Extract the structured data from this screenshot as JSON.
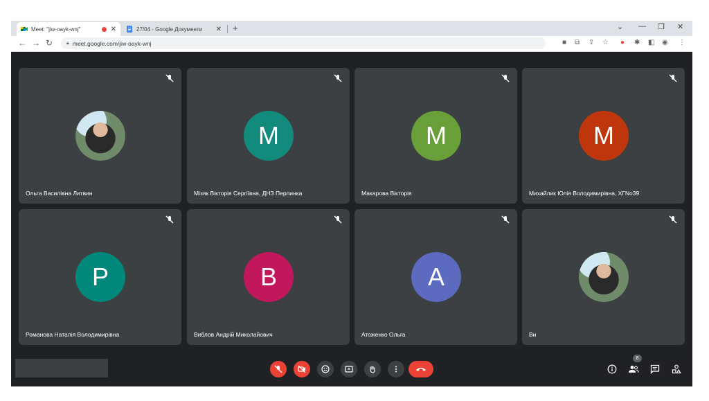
{
  "browser": {
    "tabs": [
      {
        "title": "Meet: \"jiw-oayk-wnj\"",
        "active": true,
        "recording": true
      },
      {
        "title": "27/04 - Google Документи",
        "active": false
      }
    ],
    "address": "meet.google.com/jiw-oayk-wnj"
  },
  "meet": {
    "participants": [
      {
        "name": "Ольга Василівна Литвин",
        "initial": "",
        "photo": true,
        "color": ""
      },
      {
        "name": "Мізяк Вікторія Сергіївна, ДНЗ Перлинка",
        "initial": "M",
        "color": "#128a7c"
      },
      {
        "name": "Макарова Вікторія",
        "initial": "M",
        "color": "#689f38"
      },
      {
        "name": "Михайлик Юлія Володимирівна, ХГNo39",
        "initial": "M",
        "color": "#bf360c"
      },
      {
        "name": "Романова Наталія Володимирівна",
        "initial": "P",
        "color": "#00897b"
      },
      {
        "name": "Виблов Андрій Миколайович",
        "initial": "B",
        "color": "#c2185b"
      },
      {
        "name": "Атоженко Ольга",
        "initial": "A",
        "color": "#5c6bc0"
      },
      {
        "name": "Ви",
        "initial": "",
        "photo": true,
        "color": ""
      }
    ],
    "participant_count": "8",
    "colors": {
      "background": "#202124",
      "tile": "#3c4043",
      "danger": "#ea4335"
    }
  }
}
